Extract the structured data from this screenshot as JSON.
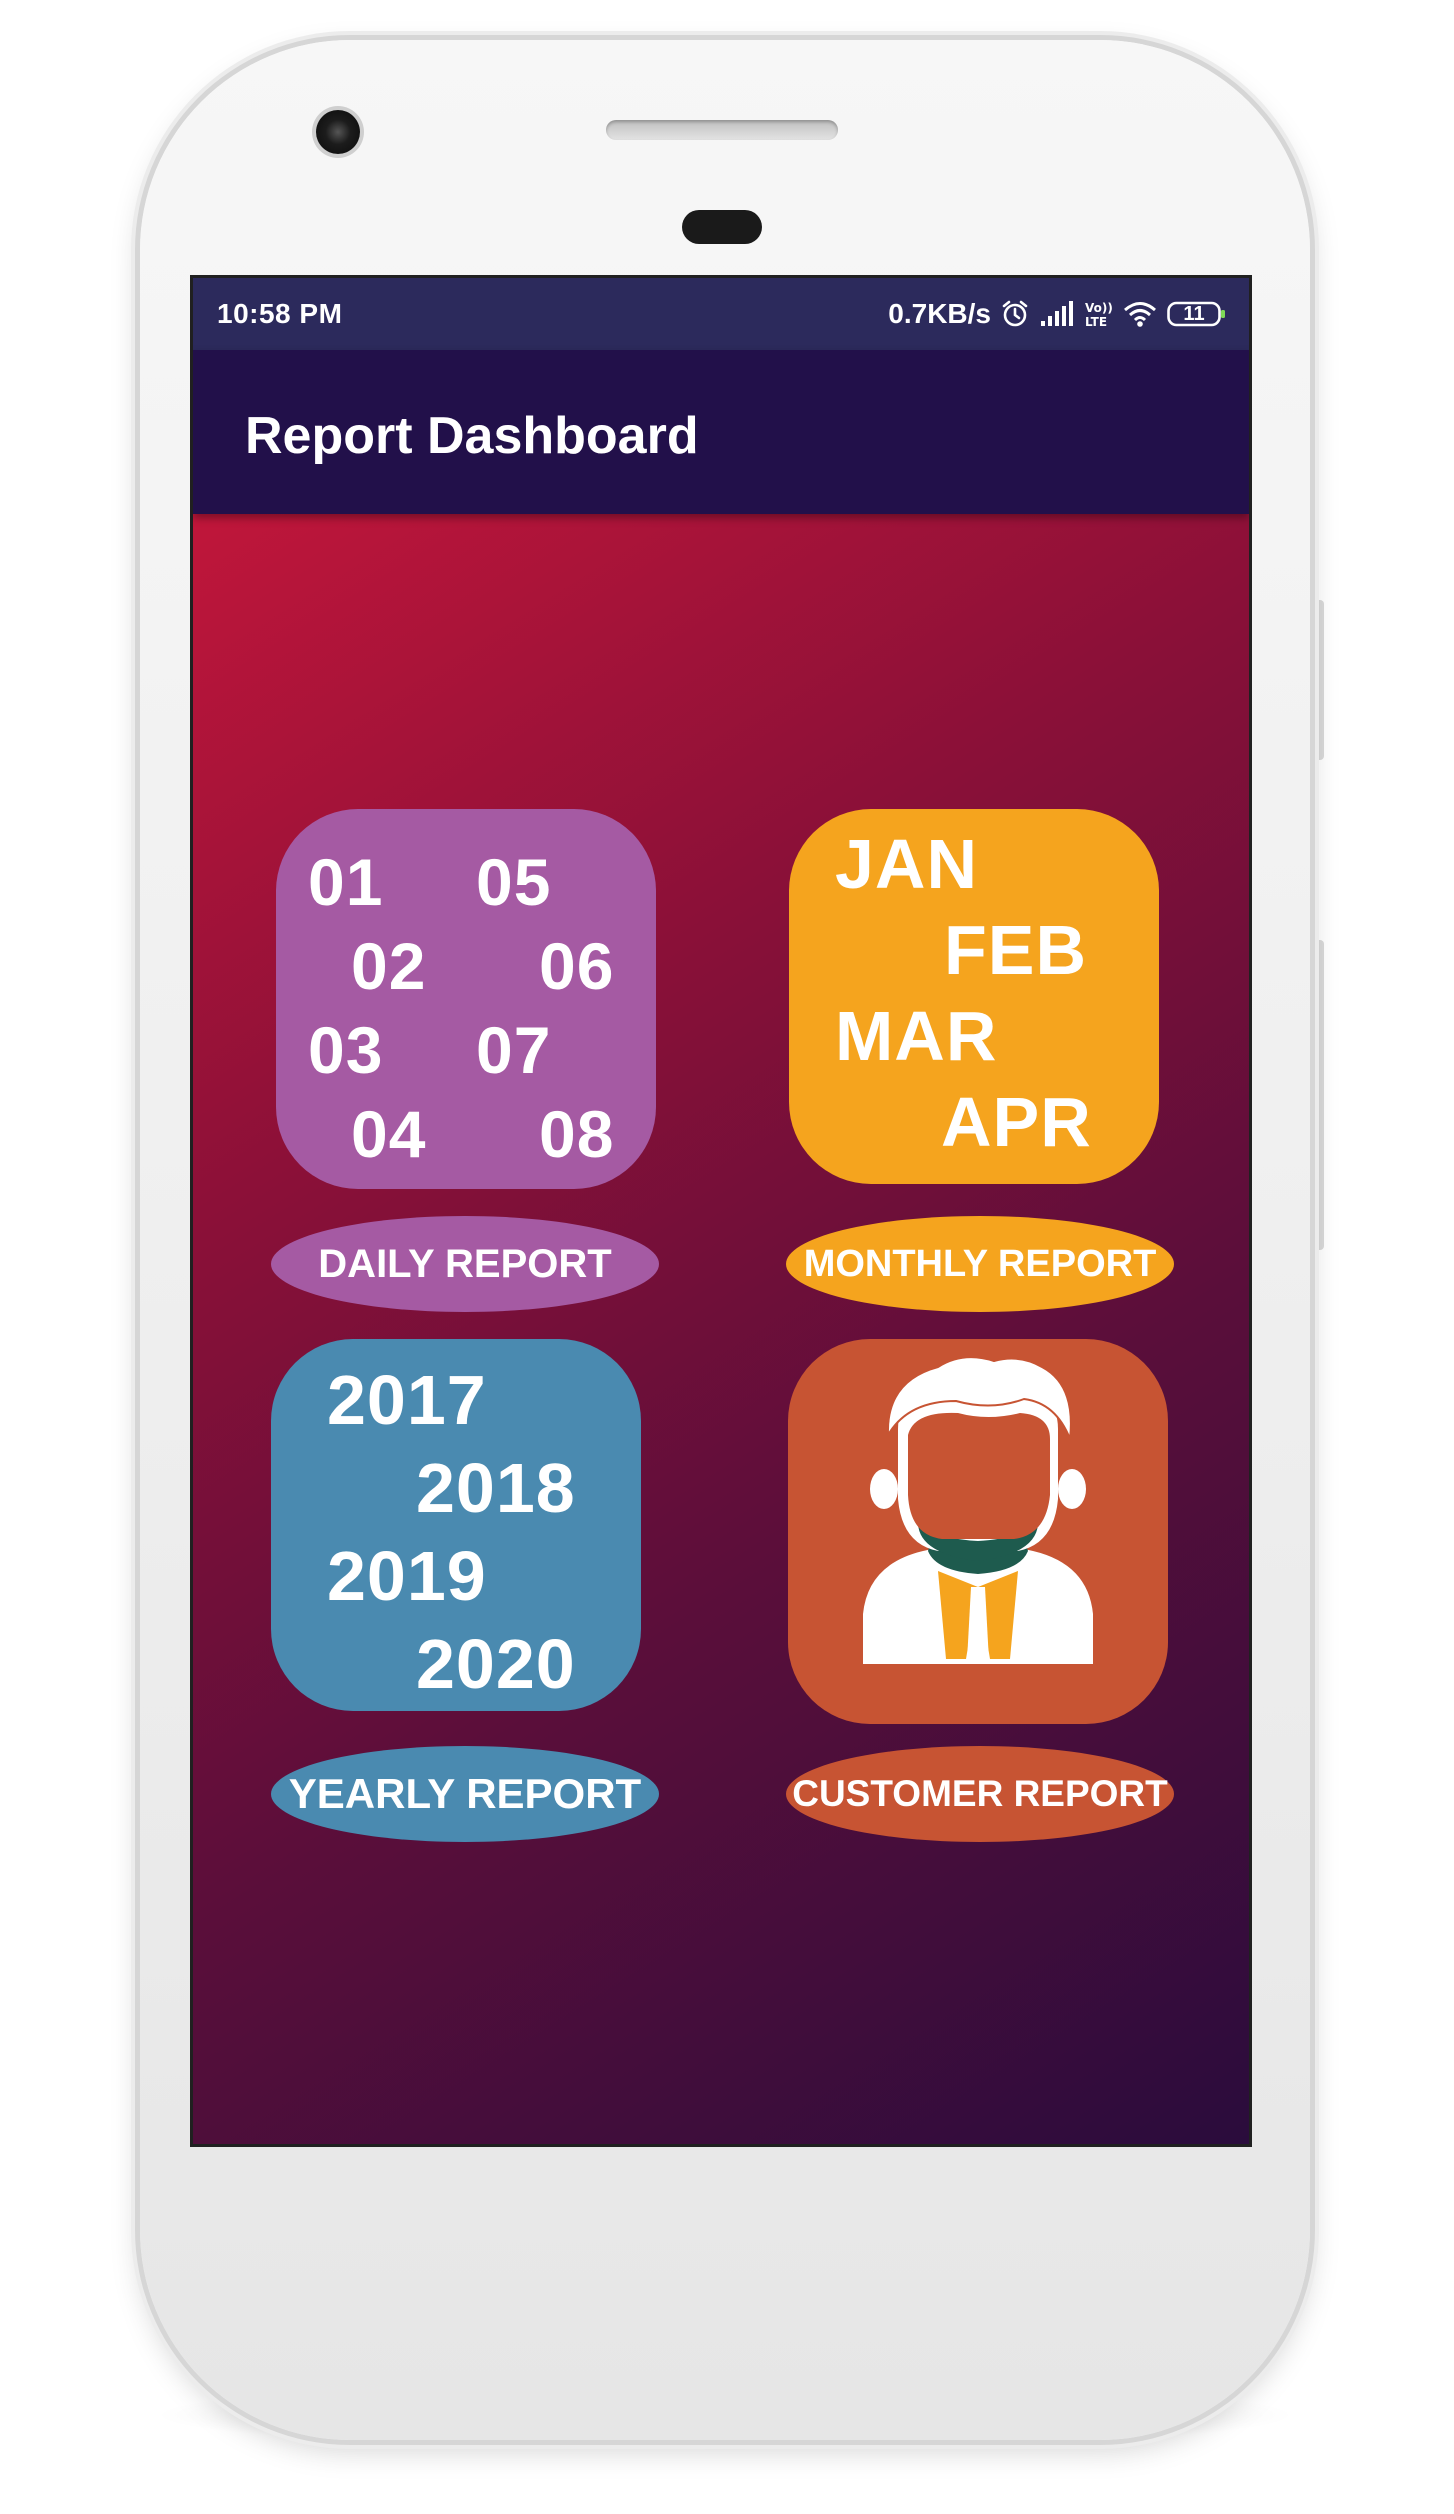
{
  "status_bar": {
    "time": "10:58 PM",
    "net_speed": "0.7KB/s",
    "battery": "11",
    "icons": [
      "alarm-icon",
      "signal-icon",
      "volte-icon",
      "wifi-icon",
      "battery-icon"
    ]
  },
  "app_bar": {
    "title": "Report Dashboard"
  },
  "tiles": {
    "daily": {
      "numbers": [
        "01",
        "05",
        "02",
        "06",
        "03",
        "07",
        "04",
        "08"
      ],
      "label": "DAILY REPORT",
      "color": "#a55aa3"
    },
    "monthly": {
      "months": [
        "JAN",
        "FEB",
        "MAR",
        "APR"
      ],
      "label": "MONTHLY REPORT",
      "color": "#f5a41e"
    },
    "yearly": {
      "years": [
        "2017",
        "2018",
        "2019",
        "2020"
      ],
      "label": "YEARLY REPORT",
      "color": "#4a8ab0"
    },
    "customer": {
      "icon": "customer-avatar-icon",
      "label": "CUSTOMER REPORT",
      "color": "#c75433"
    }
  },
  "theme": {
    "status_bar_color": "#2c2a5c",
    "app_bar_color": "#22104a",
    "gradient_start": "#c0163a",
    "gradient_end": "#2a0c3c"
  }
}
